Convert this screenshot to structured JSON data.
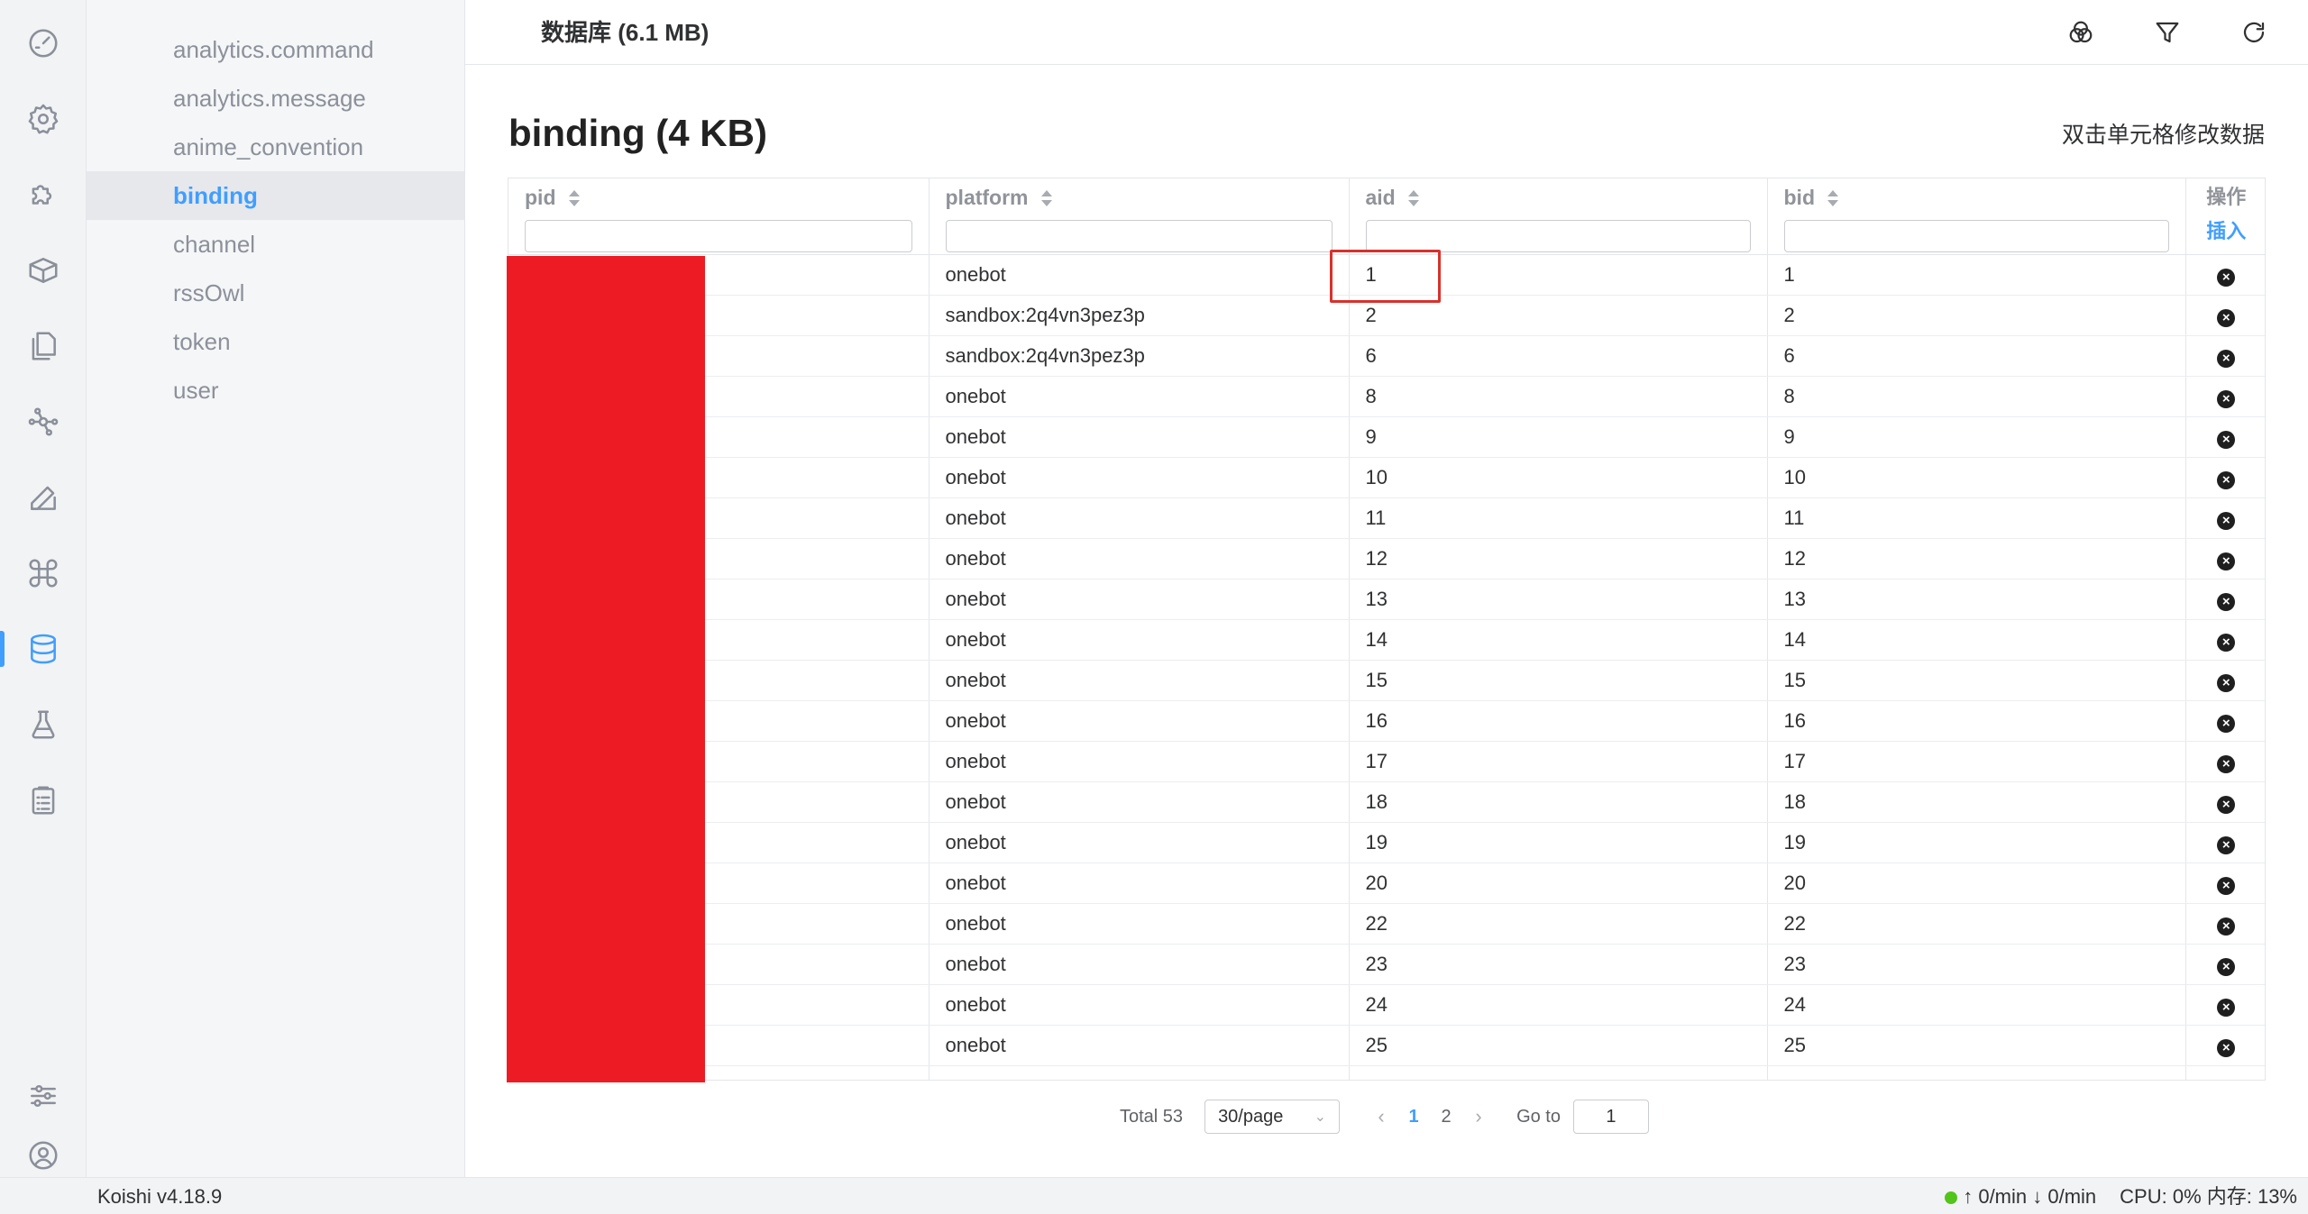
{
  "activity_bar": {
    "items": [
      {
        "icon": "dashboard-icon",
        "active": false
      },
      {
        "icon": "gear-icon",
        "active": false
      },
      {
        "icon": "puzzle-icon",
        "active": false
      },
      {
        "icon": "package-icon",
        "active": false
      },
      {
        "icon": "files-icon",
        "active": false
      },
      {
        "icon": "network-icon",
        "active": false
      },
      {
        "icon": "edit-icon",
        "active": false
      },
      {
        "icon": "command-icon",
        "active": false
      },
      {
        "icon": "database-icon",
        "active": true
      },
      {
        "icon": "flask-icon",
        "active": false
      },
      {
        "icon": "clipboard-icon",
        "active": false
      }
    ],
    "bottom": [
      {
        "icon": "sliders-icon"
      },
      {
        "icon": "user-circle-icon"
      }
    ]
  },
  "sidebar": {
    "tables": [
      "analytics.command",
      "analytics.message",
      "anime_convention",
      "binding",
      "channel",
      "rssOwl",
      "token",
      "user"
    ],
    "active": "binding"
  },
  "header": {
    "title": "数据库 (6.1 MB)",
    "actions": [
      "venn-icon",
      "filter-icon",
      "refresh-icon"
    ]
  },
  "main": {
    "title": "binding (4 KB)",
    "hint": "双击单元格修改数据",
    "columns": [
      "pid",
      "platform",
      "aid",
      "bid"
    ],
    "op_label": "操作",
    "insert_label": "插入",
    "rows": [
      {
        "pid": "",
        "platform": "onebot",
        "aid": "1",
        "bid": "1"
      },
      {
        "pid": "",
        "platform": "sandbox:2q4vn3pez3p",
        "aid": "2",
        "bid": "2"
      },
      {
        "pid": "",
        "platform": "sandbox:2q4vn3pez3p",
        "aid": "6",
        "bid": "6"
      },
      {
        "pid": "",
        "platform": "onebot",
        "aid": "8",
        "bid": "8"
      },
      {
        "pid": "",
        "platform": "onebot",
        "aid": "9",
        "bid": "9"
      },
      {
        "pid": "",
        "platform": "onebot",
        "aid": "10",
        "bid": "10"
      },
      {
        "pid": "",
        "platform": "onebot",
        "aid": "11",
        "bid": "11"
      },
      {
        "pid": "",
        "platform": "onebot",
        "aid": "12",
        "bid": "12"
      },
      {
        "pid": "",
        "platform": "onebot",
        "aid": "13",
        "bid": "13"
      },
      {
        "pid": "",
        "platform": "onebot",
        "aid": "14",
        "bid": "14"
      },
      {
        "pid": "",
        "platform": "onebot",
        "aid": "15",
        "bid": "15"
      },
      {
        "pid": "",
        "platform": "onebot",
        "aid": "16",
        "bid": "16"
      },
      {
        "pid": "",
        "platform": "onebot",
        "aid": "17",
        "bid": "17"
      },
      {
        "pid": "",
        "platform": "onebot",
        "aid": "18",
        "bid": "18"
      },
      {
        "pid": "",
        "platform": "onebot",
        "aid": "19",
        "bid": "19"
      },
      {
        "pid": "",
        "platform": "onebot",
        "aid": "20",
        "bid": "20"
      },
      {
        "pid": "",
        "platform": "onebot",
        "aid": "22",
        "bid": "22"
      },
      {
        "pid": "",
        "platform": "onebot",
        "aid": "23",
        "bid": "23"
      },
      {
        "pid": "",
        "platform": "onebot",
        "aid": "24",
        "bid": "24"
      },
      {
        "pid": "",
        "platform": "onebot",
        "aid": "25",
        "bid": "25"
      },
      {
        "pid": "",
        "platform": "",
        "aid": "",
        "bid": ""
      }
    ],
    "delete_icon": "close-circle-icon"
  },
  "pagination": {
    "total": "Total 53",
    "page_size": "30/page",
    "pages": [
      "1",
      "2"
    ],
    "current": "1",
    "goto_label": "Go to",
    "goto_value": "1"
  },
  "status_bar": {
    "version": "Koishi v4.18.9",
    "traffic": "↑ 0/min ↓ 0/min",
    "resources": "CPU: 0% 内存: 13%",
    "online_color": "#52c41a"
  },
  "colors": {
    "accent": "#409eff",
    "redaction": "#ed1c24",
    "highlight_box": "#d9312b"
  }
}
